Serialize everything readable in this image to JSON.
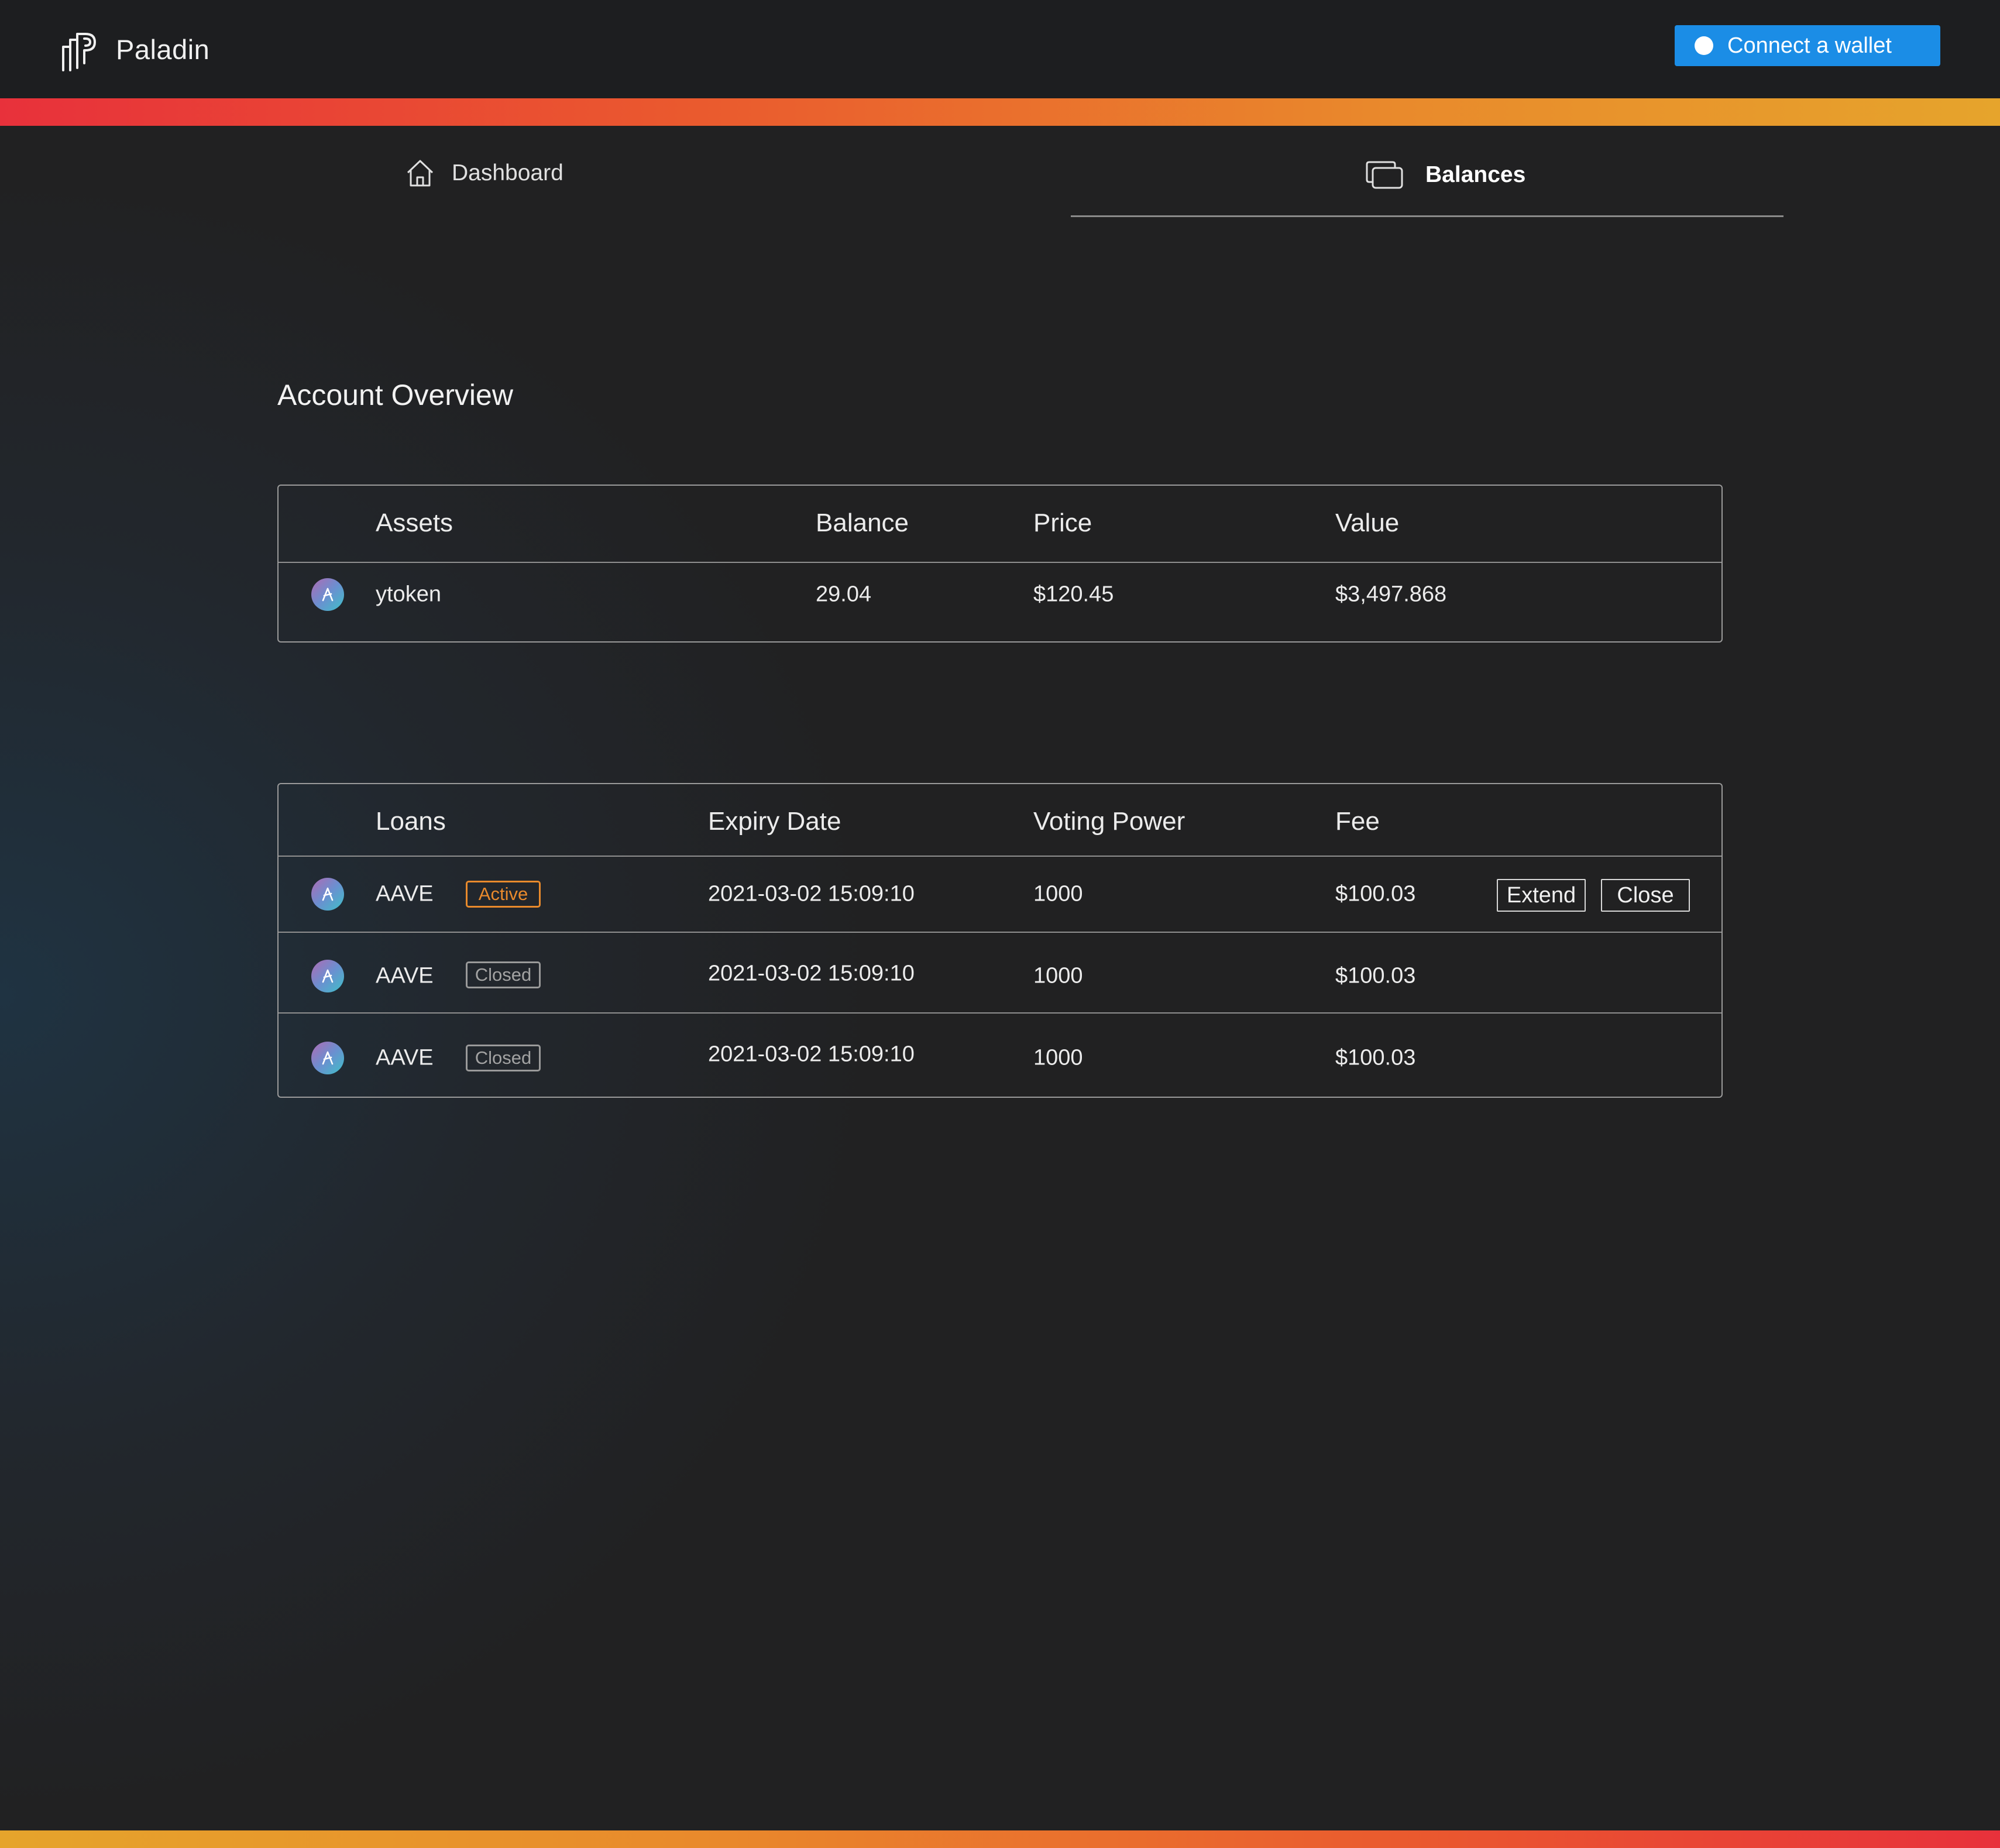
{
  "app": {
    "name": "Paladin",
    "logo_icon": "paladin-logo-icon",
    "connect_wallet_label": "Connect a wallet"
  },
  "colors": {
    "accent_primary": "#1b8de6",
    "gradient_red": "#e8313b",
    "gradient_orange": "#e6a42c",
    "status_active": "#e98a2c",
    "status_closed": "#9a9a9a"
  },
  "nav": {
    "tabs": [
      {
        "label": "Dashboard",
        "icon": "home-icon",
        "active": false
      },
      {
        "label": "Balances",
        "icon": "wallet-cards-icon",
        "active": true
      }
    ]
  },
  "main": {
    "title": "Account Overview",
    "assets_table": {
      "columns": [
        "Assets",
        "Balance",
        "Price",
        "Value"
      ],
      "rows": [
        {
          "icon": "aave-token-icon",
          "asset": "ytoken",
          "balance": "29.04",
          "price": "$120.45",
          "value": "$3,497.868"
        }
      ]
    },
    "loans_table": {
      "columns": [
        "Loans",
        "Expiry Date",
        "Voting Power",
        "Fee"
      ],
      "rows": [
        {
          "icon": "aave-token-icon",
          "token": "AAVE",
          "status": "Active",
          "expiry": "2021-03-02 15:09:10",
          "voting_power": "1000",
          "fee": "$100.03",
          "actions": [
            "Extend",
            "Close"
          ]
        },
        {
          "icon": "aave-token-icon",
          "token": "AAVE",
          "status": "Closed",
          "expiry": "2021-03-02 15:09:10",
          "voting_power": "1000",
          "fee": "$100.03",
          "actions": []
        },
        {
          "icon": "aave-token-icon",
          "token": "AAVE",
          "status": "Closed",
          "expiry": "2021-03-02 15:09:10",
          "voting_power": "1000",
          "fee": "$100.03",
          "actions": []
        }
      ]
    }
  }
}
